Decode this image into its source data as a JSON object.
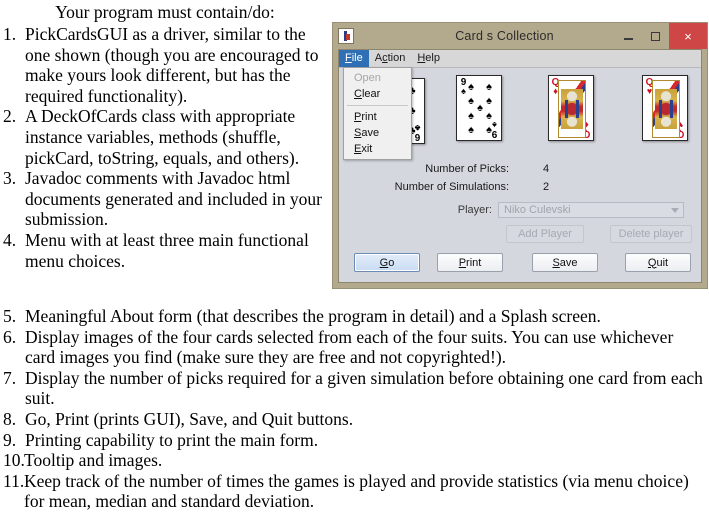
{
  "document": {
    "intro": "Your program must contain/do:",
    "requirements": [
      {
        "num": "1.",
        "text": "PickCardsGUI as a driver, similar to the one shown (though you are encouraged to make yours look different, but has the required functionality)."
      },
      {
        "num": "2.",
        "text": "A DeckOfCards class with appropriate instance variables, methods (shuffle, pickCard, toString, equals, and others)."
      },
      {
        "num": "3.",
        "text": "Javadoc comments with Javadoc html documents generated and included in your submission."
      },
      {
        "num": "4.",
        "text": "Menu with at least three main functional menu choices."
      }
    ],
    "requirements_wide": [
      {
        "num": "5.",
        "text": "Meaningful About form (that describes the program in detail) and a Splash screen."
      },
      {
        "num": "6.",
        "text": "Display images of the four cards selected from each of the four suits. You can use whichever card images you find (make sure they are free and not copyrighted!)."
      },
      {
        "num": "7.",
        "text": "Display the number of picks required for a given simulation before obtaining one card from each suit."
      },
      {
        "num": "8.",
        "text": "Go, Print (prints GUI), Save, and Quit buttons."
      },
      {
        "num": "9.",
        "text": "Printing capability to print the main form."
      },
      {
        "num": "10.",
        "text": "Tooltip and images."
      },
      {
        "num": "11.",
        "text": "Keep track of the number of times the games is played and provide statistics (via menu choice) for mean, median and standard deviation."
      }
    ]
  },
  "window": {
    "title": "Card s Collection",
    "icon": "java-app-icon",
    "controls": {
      "minimize": "minimize-icon",
      "maximize": "maximize-icon",
      "close": "×"
    },
    "colors": {
      "frame": "#b3aa8e",
      "content": "#d4d7de",
      "close_button": "#cf4646",
      "menu_highlight": "#2f6fb5",
      "card_red": "#cf1020"
    },
    "menubar": [
      {
        "label": "File",
        "mnemonic": "F",
        "active": true
      },
      {
        "label": "Action",
        "mnemonic": "A",
        "active": false
      },
      {
        "label": "Help",
        "mnemonic": "H",
        "active": false
      }
    ],
    "file_menu": [
      {
        "label": "Open",
        "mnemonic": "O",
        "disabled": true
      },
      {
        "label": "Clear",
        "mnemonic": "C",
        "disabled": false
      },
      {
        "separator": true
      },
      {
        "label": "Print",
        "mnemonic": "P",
        "disabled": false
      },
      {
        "label": "Save",
        "mnemonic": "S",
        "disabled": false
      },
      {
        "label": "Exit",
        "mnemonic": "E",
        "disabled": false
      }
    ],
    "cards": [
      {
        "rank": "6",
        "suit": "clubs",
        "suit_symbol": "♣",
        "color": "black",
        "face": false
      },
      {
        "rank": "9",
        "suit": "spades",
        "suit_symbol": "♠",
        "color": "black",
        "face": false
      },
      {
        "rank": "Q",
        "suit": "diamonds",
        "suit_symbol": "♦",
        "color": "red",
        "face": true
      },
      {
        "rank": "Q",
        "suit": "hearts",
        "suit_symbol": "♥",
        "color": "red",
        "face": true
      }
    ],
    "info": [
      {
        "label": "Number of Picks:",
        "value": "4"
      },
      {
        "label": "Number of Simulations:",
        "value": "2"
      }
    ],
    "player": {
      "label": "Player:",
      "selected": "Niko Culevski",
      "dropdown_icon": "chevron-down-icon",
      "add_button": "Add Player",
      "delete_button": "Delete player"
    },
    "buttons": [
      {
        "label": "Go",
        "mnemonic": "G",
        "focused": true
      },
      {
        "label": "Print",
        "mnemonic": "P",
        "focused": false
      },
      {
        "label": "Save",
        "mnemonic": "S",
        "focused": false
      },
      {
        "label": "Quit",
        "mnemonic": "Q",
        "focused": false
      }
    ]
  }
}
